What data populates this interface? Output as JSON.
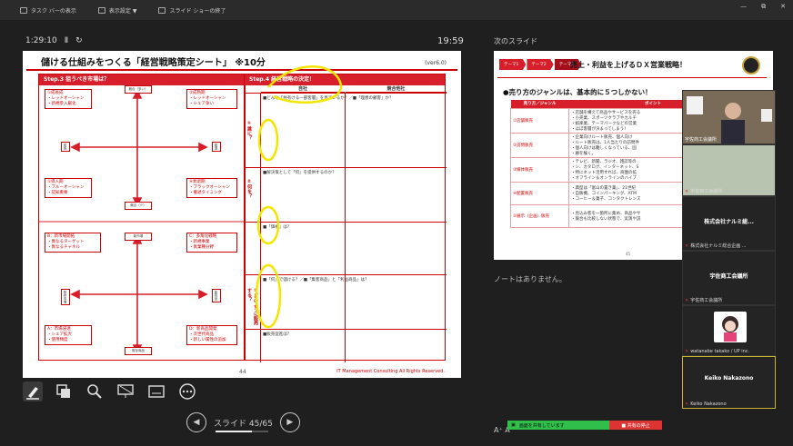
{
  "topbar": {
    "taskbar": "タスク バーの表示",
    "display": "表示設定 ▼",
    "end": "スライド ショーの終了",
    "minimize": "—",
    "maximize": "⧉",
    "close": "✕"
  },
  "presenter": {
    "elapsed": "1:29:10",
    "pause": "Ⅱ",
    "reset": "↻",
    "clock": "19:59",
    "next_label": "次のスライド",
    "notes": "ノートはありません。",
    "slide_counter": "スライド 45/65",
    "progress_fraction": 0.69,
    "prev": "◀",
    "next": "▶",
    "zoom": "A⁺ A⁻"
  },
  "slide": {
    "title": "儲ける仕組みをつくる「経営戦略策定シート」 ※10分",
    "version": "(ver6.0)",
    "step3": "Step.3 狙うべき市場は？",
    "step4": "Step.4 経営戦略の決定！",
    "col1": "自社",
    "col2": "競合他社",
    "q_who": "①誰に？",
    "q_what": "②何を？",
    "q_how": "③どのように販売する？",
    "r1": "■どんな「共有ける一部客層」を見ているか？／■「理想の顧客」か？",
    "r2": "■解決策として「何」を提供するのか？",
    "r3": "■「価格」は？",
    "r4": "■「何」で儲ける？／■「集客商品」と「利益商品」は？",
    "r5": "■販売促進は？",
    "qA": "①成長成\n・レッドオーシャン\n・新規参入厳化",
    "qB": "②成熟期\n・レッドオーシャン\n・シェア争い",
    "qC": "①導入期\n・ブルーオーシャン\n・認知重要",
    "qD": "④衰退期\n・ブラックオーシャン\n・撤退タイミング",
    "qE": "B：新市場開拓\n・異なるターゲット\n・異なるチャネル",
    "qF": "C：多角化戦略\n・新規事業\n・異業種分野",
    "qG": "A：市場浸透\n・シェア拡大\n・使用頻度",
    "qH": "D：新商品開発\n・次世代商品\n・新しい属性の追加",
    "ax1": "競合（多い）",
    "ax2": "成長",
    "ax3": "衰退",
    "ax4": "競合（少）",
    "ax5": "新市場",
    "ax6": "既存市場",
    "ax7": "新商品",
    "ax8": "既存商品",
    "footer": "IT Management Consulting All Rights Reserved.",
    "page": "44"
  },
  "next_slide": {
    "tab1": "テーマ1",
    "tab2": "テーマ2",
    "tab3": "テーマ3",
    "title": "売上・利益を上げるＤＸ営業戦略！",
    "subtitle": "●売り方のジャンルは、基本的に５つしかない！",
    "col1": "売り方／ジャンル",
    "col2": "ポイント",
    "rows": [
      {
        "k": "①店舗販売",
        "v": "・店舗を構えて商品やサービスを売る\n・小売業、スポーツクラブやカルチ\n・娯楽業、テーマパークなどの営業\n・ほぼ客層が決まってしまう！"
      },
      {
        "k": "②訪問販売",
        "v": "・企業向けルート販売、個人向け\n・ルート販売は、1人当たりの訪問件\n・個人向けは難しくなっている、固\n・顧を験く。"
      },
      {
        "k": "③媒体販売",
        "v": "・テレビ、新聞、ラジオ、雑誌等の\n・シ、カタログ、インターネット、S\n・特にネット活用すれば、商圏の拡\n・オフライン＆オンラインのハイブ"
      },
      {
        "k": "④配置販売",
        "v": "・典型は「富山の置き薬」、21世紀\n・自販機、コインパーキング、ATM\n・コーヒー＆菓子、コンタクトレンズ"
      },
      {
        "k": "⑤展示（企画）販売",
        "v": "・見込み客を一箇所に集め、商品やサ\n・競合も比較しない状態で、実演や説"
      }
    ],
    "page": "45"
  },
  "participants": [
    {
      "name": "宇佐商工会議所",
      "big": ""
    },
    {
      "name": "宇佐商工会議所",
      "big": ""
    },
    {
      "name": "株式会社ナルミ総合企画 ...",
      "big": "株式会社ナルミ総..."
    },
    {
      "name": "宇佐商工会議所",
      "big": "宇佐商工会議所"
    },
    {
      "name": "watanabe takako / UP inc.",
      "big": ""
    },
    {
      "name": "Keiko Nakazono",
      "big": "Keiko Nakazono"
    }
  ],
  "share": {
    "sharing": "画面を共有しています",
    "stop": "■ 共有の停止"
  },
  "colors": {
    "accent": "#d61f2a",
    "highlight": "#f3e600",
    "share_green": "#2fbf4a"
  }
}
